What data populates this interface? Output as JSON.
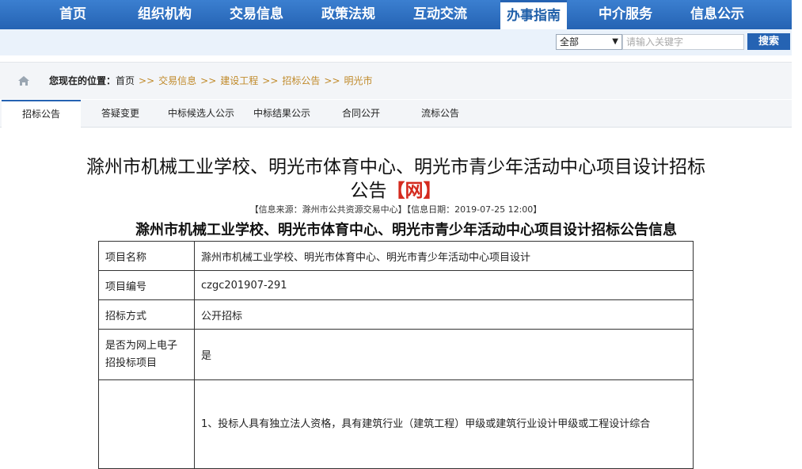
{
  "nav": {
    "items": [
      "首页",
      "组织机构",
      "交易信息",
      "政策法规",
      "互动交流",
      "办事指南",
      "中介服务",
      "信息公示"
    ],
    "active_index": 5
  },
  "search": {
    "select_value": "全部",
    "placeholder": "请输入关键字",
    "button_label": "搜索"
  },
  "breadcrumb": {
    "label": "您现在的位置：",
    "home": "首页",
    "links": [
      "交易信息",
      "建设工程",
      "招标公告",
      "明光市"
    ],
    "separator": ">>"
  },
  "tabs": {
    "items": [
      "招标公告",
      "答疑变更",
      "中标候选人公示",
      "中标结果公示",
      "合同公开",
      "流标公告"
    ],
    "active_index": 0
  },
  "article": {
    "title_line1": "滁州市机械工业学校、明光市体育中心、明光市青少年活动中心项目设计招标",
    "title_line2": "公告",
    "title_tag": "【网】",
    "meta": "【信息来源：滁州市公共资源交易中心】【信息日期：2019-07-25 12:00】",
    "subtitle": "滁州市机械工业学校、明光市体育中心、明光市青少年活动中心项目设计招标公告信息"
  },
  "table": {
    "rows": [
      {
        "key": "项目名称",
        "value": "滁州市机械工业学校、明光市体育中心、明光市青少年活动中心项目设计"
      },
      {
        "key": "项目编号",
        "value": "czgc201907-291"
      },
      {
        "key": "招标方式",
        "value": "公开招标"
      },
      {
        "key_line1": "是否为网上电子",
        "key_line2": "招投标项目",
        "value": "是"
      },
      {
        "key": "",
        "value": "1、投标人具有独立法人资格，具有建筑行业（建筑工程）甲级或建筑行业设计甲级或工程设计综合"
      }
    ]
  },
  "colors": {
    "nav_bg": "#2563b3",
    "breadcrumb_link": "#c08a2a",
    "title_tag": "#d42a1e"
  },
  "icons": {
    "home": "home-icon",
    "dropdown": "chevron-down-icon"
  }
}
